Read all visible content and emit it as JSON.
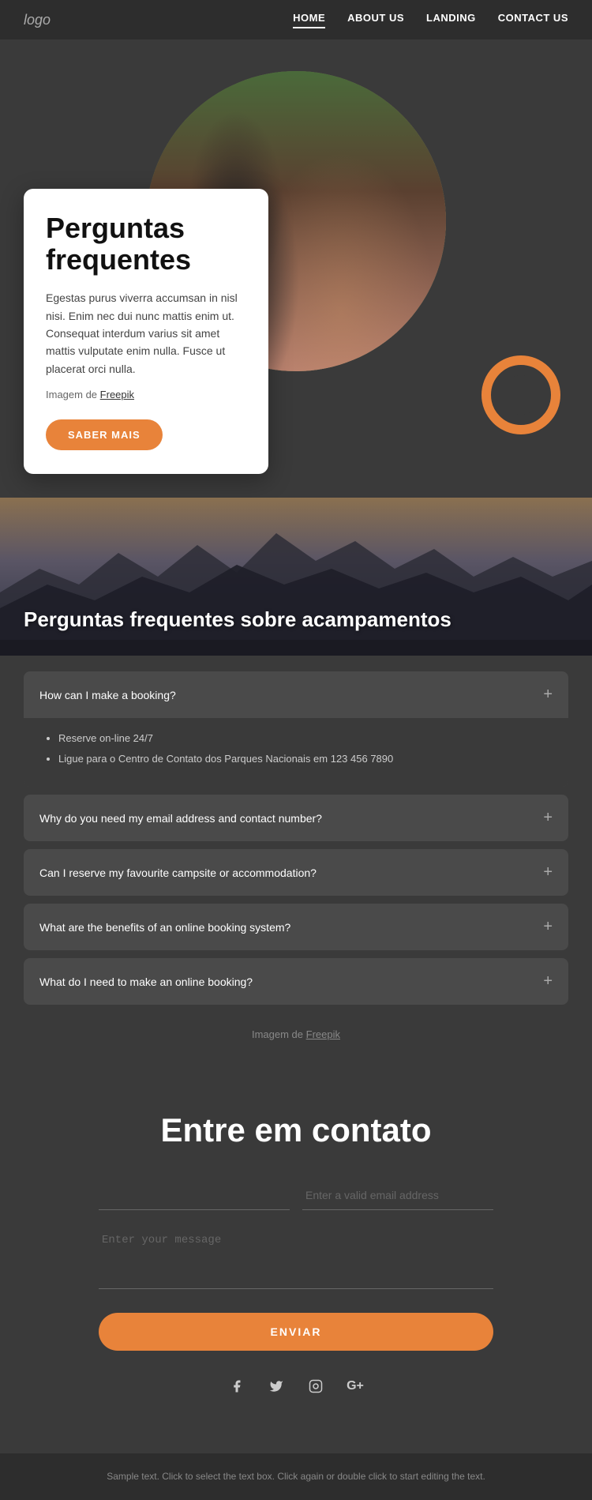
{
  "nav": {
    "logo": "logo",
    "links": [
      {
        "label": "HOME",
        "active": true
      },
      {
        "label": "ABOUT US",
        "active": false
      },
      {
        "label": "LANDING",
        "active": false
      },
      {
        "label": "CONTACT US",
        "active": false
      }
    ]
  },
  "hero": {
    "title": "Perguntas frequentes",
    "description": "Egestas purus viverra accumsan in nisl nisi. Enim nec dui nunc mattis enim ut. Consequat interdum varius sit amet mattis vulputate enim nulla. Fusce ut placerat orci nulla.",
    "attribution_text": "Imagem de",
    "attribution_link": "Freepik",
    "button_label": "SABER MAIS"
  },
  "mountain": {
    "title": "Perguntas frequentes sobre acampamentos"
  },
  "faq": {
    "attribution_text": "Imagem de",
    "attribution_link": "Freepik",
    "items": [
      {
        "question": "How can I make a booking?",
        "expanded": true,
        "answers": [
          "Reserve on-line 24/7",
          "Ligue para o Centro de Contato dos Parques Nacionais em 123 456 7890"
        ]
      },
      {
        "question": "Why do you need my email address and contact number?",
        "expanded": false,
        "answers": []
      },
      {
        "question": "Can I reserve my favourite campsite or accommodation?",
        "expanded": false,
        "answers": []
      },
      {
        "question": "What are the benefits of an online booking system?",
        "expanded": false,
        "answers": []
      },
      {
        "question": "What do I need to make an online booking?",
        "expanded": false,
        "answers": []
      }
    ]
  },
  "contact": {
    "title": "Entre em contato",
    "name_placeholder": "",
    "email_placeholder": "Enter a valid email address",
    "message_placeholder": "Enter your message",
    "button_label": "ENVIAR"
  },
  "social": {
    "icons": [
      "f",
      "t",
      "ig",
      "g+"
    ]
  },
  "footer": {
    "text": "Sample text. Click to select the text box. Click again or double click to start editing the text."
  }
}
